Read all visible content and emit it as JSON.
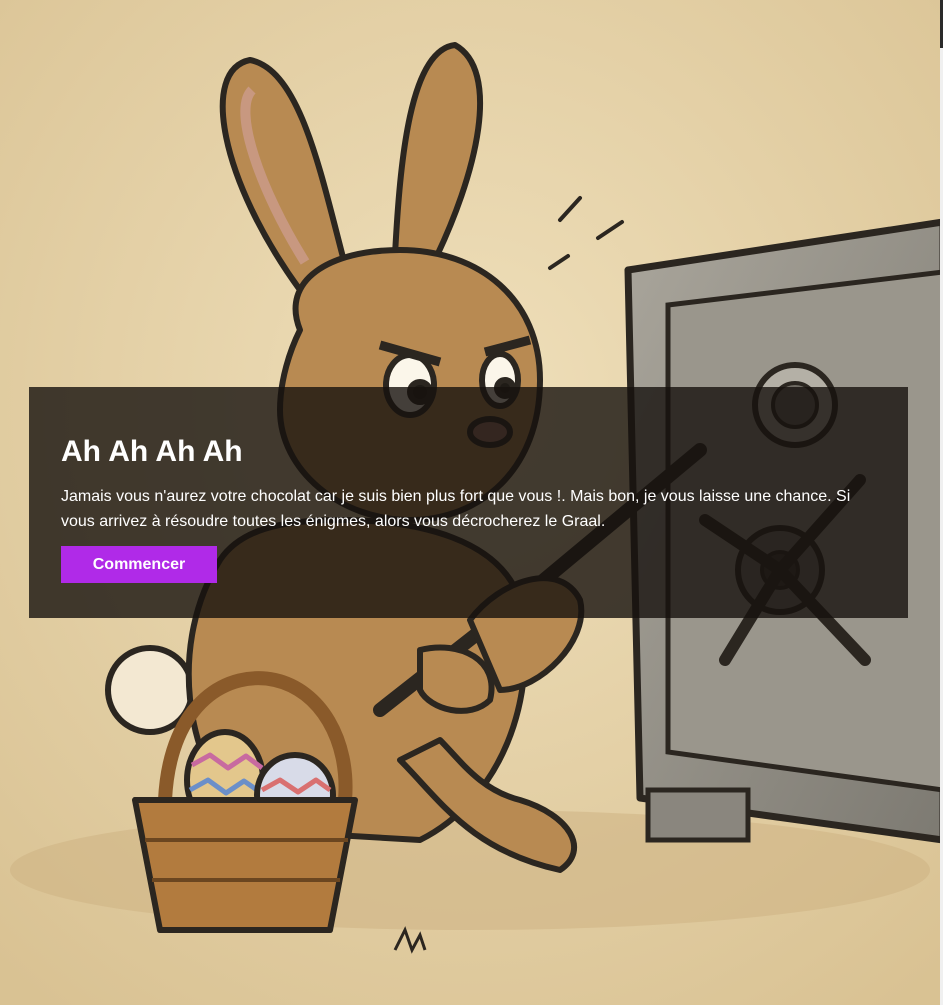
{
  "hero": {
    "title": "Ah Ah Ah Ah",
    "description": "Jamais vous n'aurez votre chocolat car je suis bien plus fort que vous !. Mais bon, je vous laisse une chance. Si vous arrivez à résoudre toutes les énigmes, alors vous décrocherez le Graal.",
    "start_label": "Commencer"
  },
  "illustration": {
    "subject": "bunny-breaking-into-safe",
    "colors": {
      "paper": "#e9d6ae",
      "fur": "#b88a52",
      "safe": "#8f8c84",
      "button": "#b02ae8"
    }
  }
}
